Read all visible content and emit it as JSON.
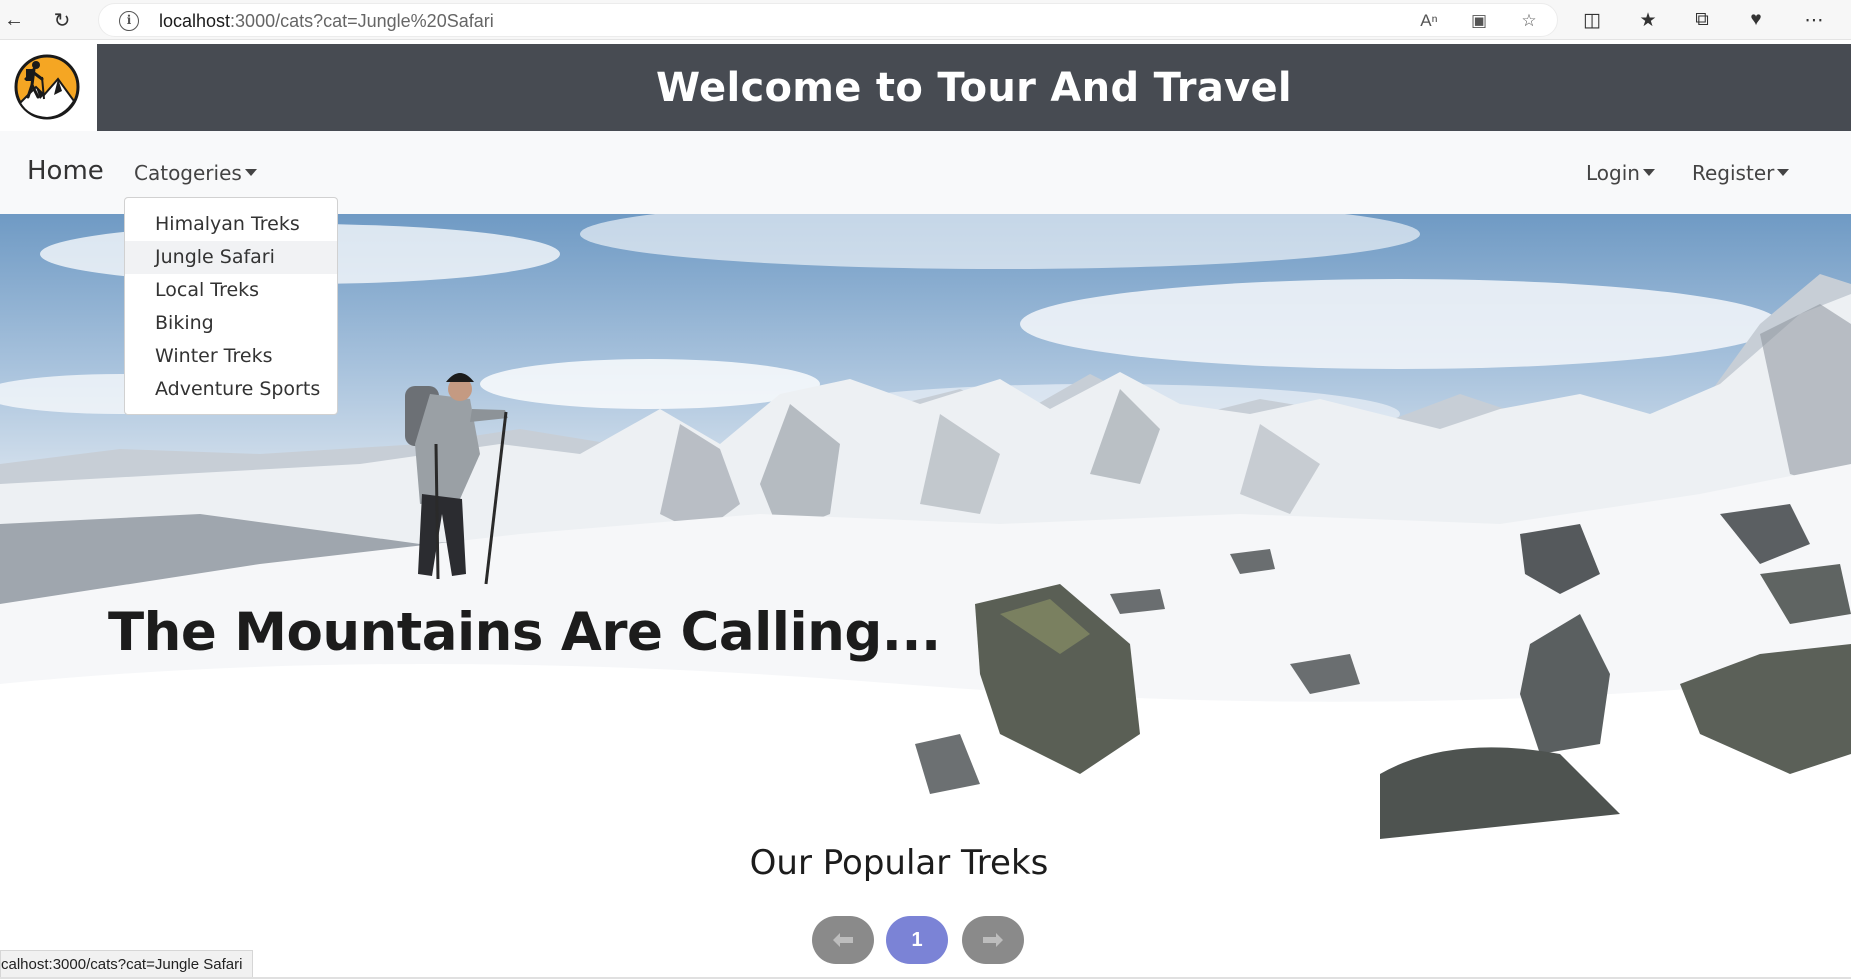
{
  "browser": {
    "url_host": "localhost",
    "url_path": ":3000/cats?cat=Jungle%20Safari",
    "status_url": "calhost:3000/cats?cat=Jungle Safari"
  },
  "header": {
    "title": "Welcome to Tour And Travel"
  },
  "navbar": {
    "home": "Home",
    "categories": "Catogeries",
    "login": "Login",
    "register": "Register"
  },
  "dropdown": {
    "items": [
      "Himalyan Treks",
      "Jungle Safari",
      "Local Treks",
      "Biking",
      "Winter Treks",
      "Adventure Sports"
    ],
    "hovered": "Jungle Safari"
  },
  "hero": {
    "caption": "The Mountains Are Calling..."
  },
  "section": {
    "title": "Our Popular Treks"
  },
  "pager": {
    "current": "1"
  },
  "colors": {
    "banner": "#474b52",
    "pager_active": "#7b83d6",
    "pager_arrow": "#8a8a8a",
    "logo_orange": "#f5a623"
  }
}
